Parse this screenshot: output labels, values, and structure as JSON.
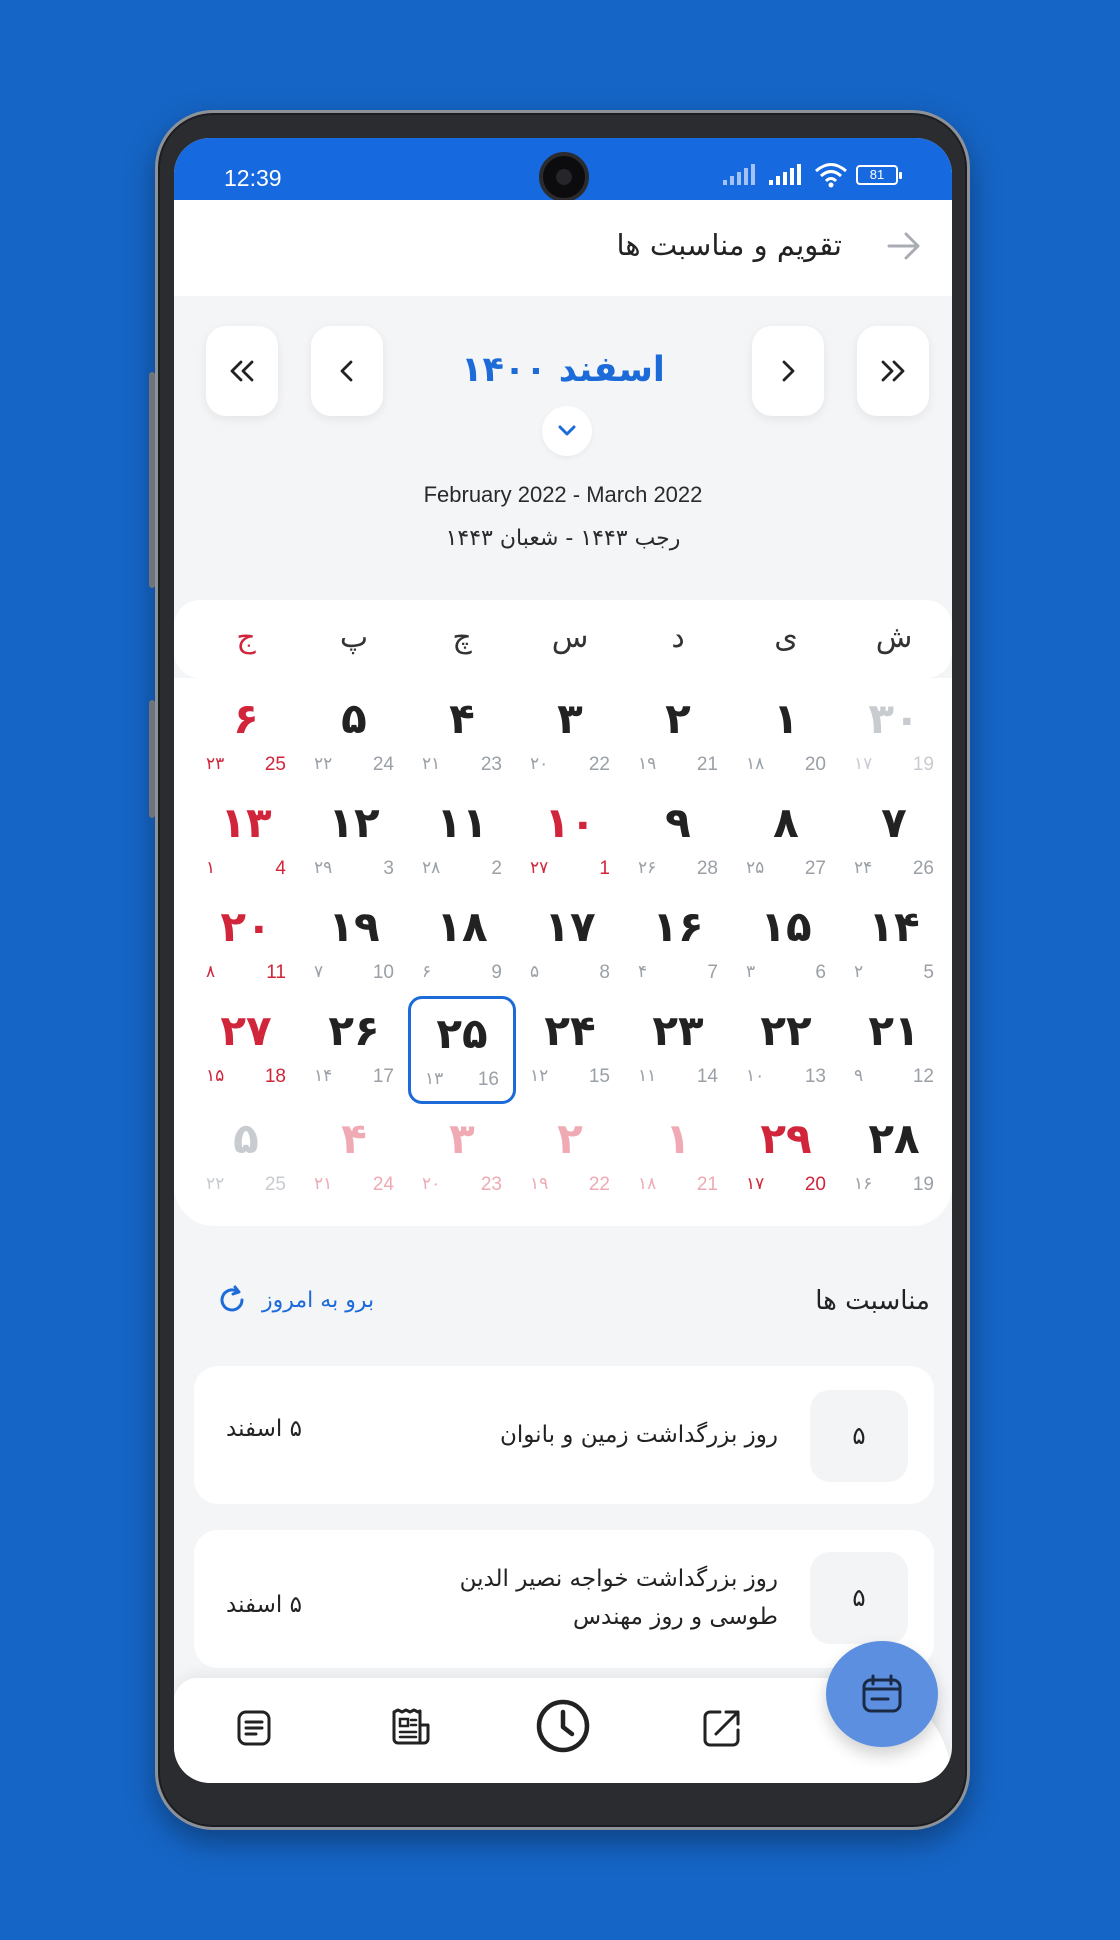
{
  "status": {
    "time": "12:39",
    "battery": "81"
  },
  "header": {
    "title": "تقویم و مناسبت ها",
    "back_icon": "arrow-right-icon"
  },
  "month": {
    "title": "اسفند ۱۴۰۰",
    "gregorian_range": "February 2022 - March 2022",
    "hijri_range": "رجب ۱۴۴۳ - شعبان ۱۴۴۳"
  },
  "weekdays": [
    "ش",
    "ی",
    "د",
    "س",
    "چ",
    "پ",
    "ج"
  ],
  "calendar": [
    [
      {
        "p": "۳۰",
        "g": "19",
        "h": "۱۷",
        "s": "dim"
      },
      {
        "p": "۱",
        "g": "20",
        "h": "۱۸",
        "s": ""
      },
      {
        "p": "۲",
        "g": "21",
        "h": "۱۹",
        "s": ""
      },
      {
        "p": "۳",
        "g": "22",
        "h": "۲۰",
        "s": ""
      },
      {
        "p": "۴",
        "g": "23",
        "h": "۲۱",
        "s": ""
      },
      {
        "p": "۵",
        "g": "24",
        "h": "۲۲",
        "s": ""
      },
      {
        "p": "۶",
        "g": "25",
        "h": "۲۳",
        "s": "holiday"
      }
    ],
    [
      {
        "p": "۷",
        "g": "26",
        "h": "۲۴",
        "s": ""
      },
      {
        "p": "۸",
        "g": "27",
        "h": "۲۵",
        "s": ""
      },
      {
        "p": "۹",
        "g": "28",
        "h": "۲۶",
        "s": ""
      },
      {
        "p": "۱۰",
        "g": "1",
        "h": "۲۷",
        "s": "holiday"
      },
      {
        "p": "۱۱",
        "g": "2",
        "h": "۲۸",
        "s": ""
      },
      {
        "p": "۱۲",
        "g": "3",
        "h": "۲۹",
        "s": ""
      },
      {
        "p": "۱۳",
        "g": "4",
        "h": "۱",
        "s": "holiday"
      }
    ],
    [
      {
        "p": "۱۴",
        "g": "5",
        "h": "۲",
        "s": ""
      },
      {
        "p": "۱۵",
        "g": "6",
        "h": "۳",
        "s": ""
      },
      {
        "p": "۱۶",
        "g": "7",
        "h": "۴",
        "s": ""
      },
      {
        "p": "۱۷",
        "g": "8",
        "h": "۵",
        "s": ""
      },
      {
        "p": "۱۸",
        "g": "9",
        "h": "۶",
        "s": ""
      },
      {
        "p": "۱۹",
        "g": "10",
        "h": "۷",
        "s": ""
      },
      {
        "p": "۲۰",
        "g": "11",
        "h": "۸",
        "s": "holiday"
      }
    ],
    [
      {
        "p": "۲۱",
        "g": "12",
        "h": "۹",
        "s": ""
      },
      {
        "p": "۲۲",
        "g": "13",
        "h": "۱۰",
        "s": ""
      },
      {
        "p": "۲۳",
        "g": "14",
        "h": "۱۱",
        "s": ""
      },
      {
        "p": "۲۴",
        "g": "15",
        "h": "۱۲",
        "s": ""
      },
      {
        "p": "۲۵",
        "g": "16",
        "h": "۱۳",
        "s": "today"
      },
      {
        "p": "۲۶",
        "g": "17",
        "h": "۱۴",
        "s": ""
      },
      {
        "p": "۲۷",
        "g": "18",
        "h": "۱۵",
        "s": "holiday"
      }
    ],
    [
      {
        "p": "۲۸",
        "g": "19",
        "h": "۱۶",
        "s": ""
      },
      {
        "p": "۲۹",
        "g": "20",
        "h": "۱۷",
        "s": "holiday"
      },
      {
        "p": "۱",
        "g": "21",
        "h": "۱۸",
        "s": "dimred"
      },
      {
        "p": "۲",
        "g": "22",
        "h": "۱۹",
        "s": "dimred"
      },
      {
        "p": "۳",
        "g": "23",
        "h": "۲۰",
        "s": "dimred"
      },
      {
        "p": "۴",
        "g": "24",
        "h": "۲۱",
        "s": "dimred"
      },
      {
        "p": "۵",
        "g": "25",
        "h": "۲۲",
        "s": "dim"
      }
    ]
  ],
  "occasions": {
    "title": "مناسبت ها",
    "go_today": "برو به امروز",
    "items": [
      {
        "num": "۵",
        "text": "روز بزرگداشت زمین و بانوان",
        "date": "۵ اسفند"
      },
      {
        "num": "۵",
        "text": "روز بزرگداشت خواجه نصیر الدین طوسی و روز مهندس",
        "date": "۵ اسفند"
      }
    ]
  },
  "bottom_nav": [
    "notes-icon",
    "news-icon",
    "clock-icon",
    "share-icon"
  ],
  "fab_icon": "calendar-icon",
  "colors": {
    "accent": "#1c6bd8",
    "holiday": "#d0253a",
    "background": "#1565c6"
  }
}
